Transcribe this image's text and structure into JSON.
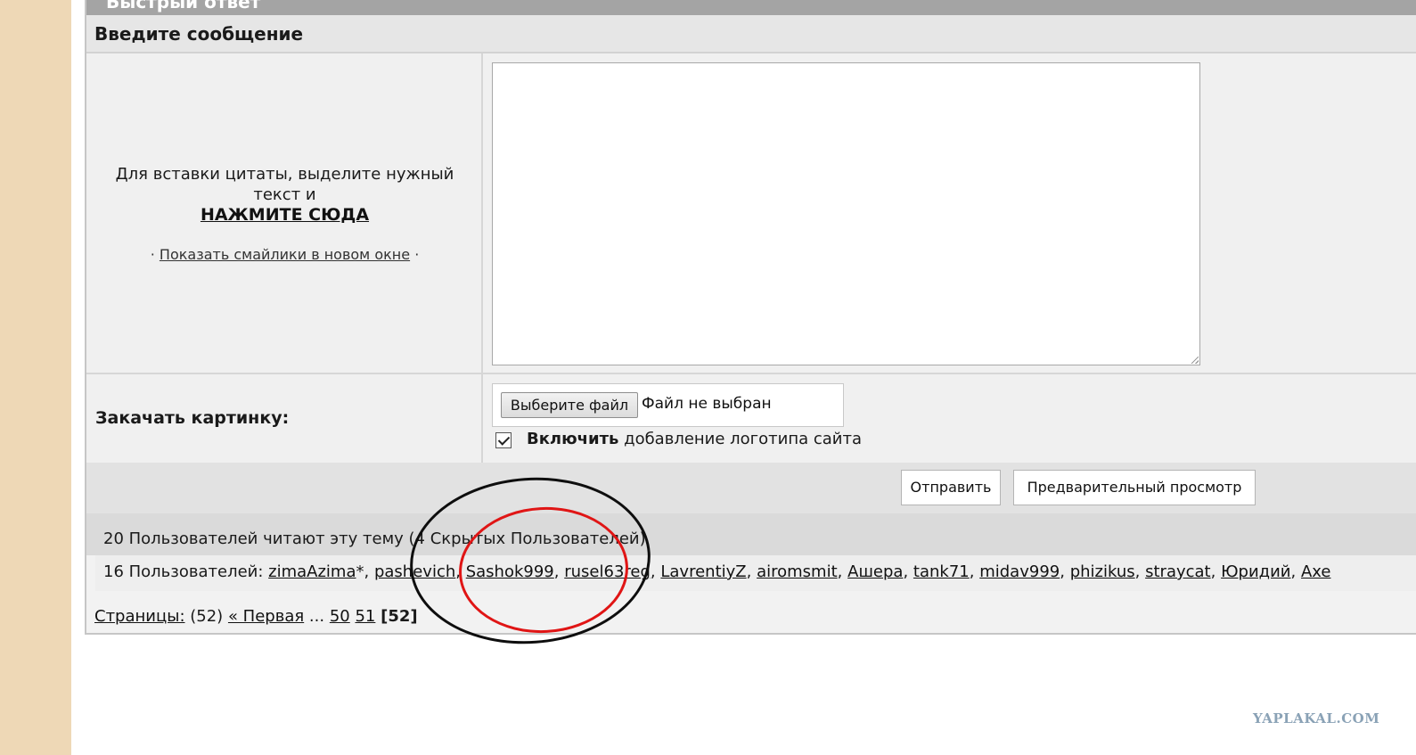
{
  "form": {
    "top_title": "Быстрый ответ",
    "header": "Введите сообщение",
    "quote_hint": "Для вставки цитаты, выделите нужный текст и",
    "quote_link": "НАЖМИТЕ СЮДА",
    "smileys_bullet_left": "·",
    "smileys_link": "Показать смайлики в новом окне",
    "smileys_bullet_right": "·",
    "message_value": ""
  },
  "upload": {
    "label": "Закачать картинку:",
    "choose_button": "Выберите файл",
    "file_status": "Файл не выбран",
    "logo_checked": true,
    "logo_bold": "Включить",
    "logo_text": " добавление логотипа сайта"
  },
  "actions": {
    "submit": "Отправить",
    "preview": "Предварительный просмотр"
  },
  "readers": {
    "summary": "20 Пользователей читают эту тему (4 Скрытых Пользователей)",
    "users_prefix": "16 Пользователей:",
    "users": [
      {
        "name": "zimaAzima",
        "suffix": "*"
      },
      {
        "name": "pashevich",
        "suffix": ""
      },
      {
        "name": "Sashok999",
        "suffix": ""
      },
      {
        "name": "rusel63reg",
        "suffix": ""
      },
      {
        "name": "LavrentiyZ",
        "suffix": ""
      },
      {
        "name": "airomsmit",
        "suffix": ""
      },
      {
        "name": "Ашера",
        "suffix": ""
      },
      {
        "name": "tank71",
        "suffix": ""
      },
      {
        "name": "midav999",
        "suffix": ""
      },
      {
        "name": "phizikus",
        "suffix": ""
      },
      {
        "name": "straycat",
        "suffix": ""
      },
      {
        "name": "Юридий",
        "suffix": ""
      },
      {
        "name": "Axe",
        "suffix": ""
      }
    ]
  },
  "pagination": {
    "label": "Страницы:",
    "count": "(52)",
    "first": "« Первая",
    "ellipsis": "...",
    "pages": [
      "50",
      "51"
    ],
    "current": "[52]"
  },
  "watermark": "YAPLAKAL.COM",
  "colors": {
    "side_strip": "#eed8b6",
    "annotation_black": "#0e0e0e",
    "annotation_red": "#e01515"
  }
}
